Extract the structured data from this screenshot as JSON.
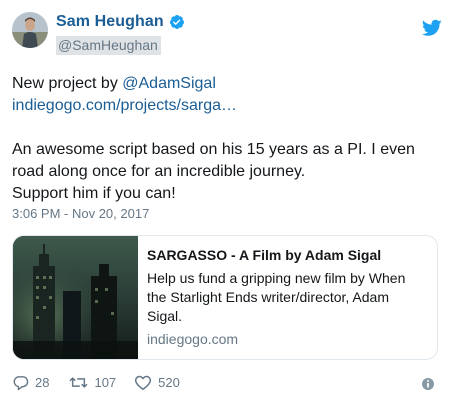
{
  "author": {
    "display_name": "Sam Heughan",
    "handle": "@SamHeughan",
    "avatar_icon": "avatar-photo",
    "verified_icon": "verified-badge-icon"
  },
  "brand_icon": "twitter-bird-icon",
  "tweet": {
    "line1_prefix": "New project by ",
    "mention": "@AdamSigal",
    "link": "indiegogo.com/projects/sarga…",
    "line3": "An awesome script based on his 15 years as a PI. I even",
    "line4": "road along once for an incredible journey.",
    "line5": "Support him if you can!",
    "timestamp": "3:06 PM - Nov 20, 2017"
  },
  "card": {
    "title": "SARGASSO - A Film by Adam Sigal",
    "description": "Help us fund a gripping new film by When the Starlight Ends writer/director, Adam Sigal.",
    "domain": "indiegogo.com"
  },
  "actions": {
    "reply_count": "28",
    "retweet_count": "107",
    "like_count": "520"
  },
  "colors": {
    "link": "#1b5e96",
    "twitter_blue": "#1da1f2",
    "muted": "#657786",
    "border": "#e1e8ed"
  }
}
